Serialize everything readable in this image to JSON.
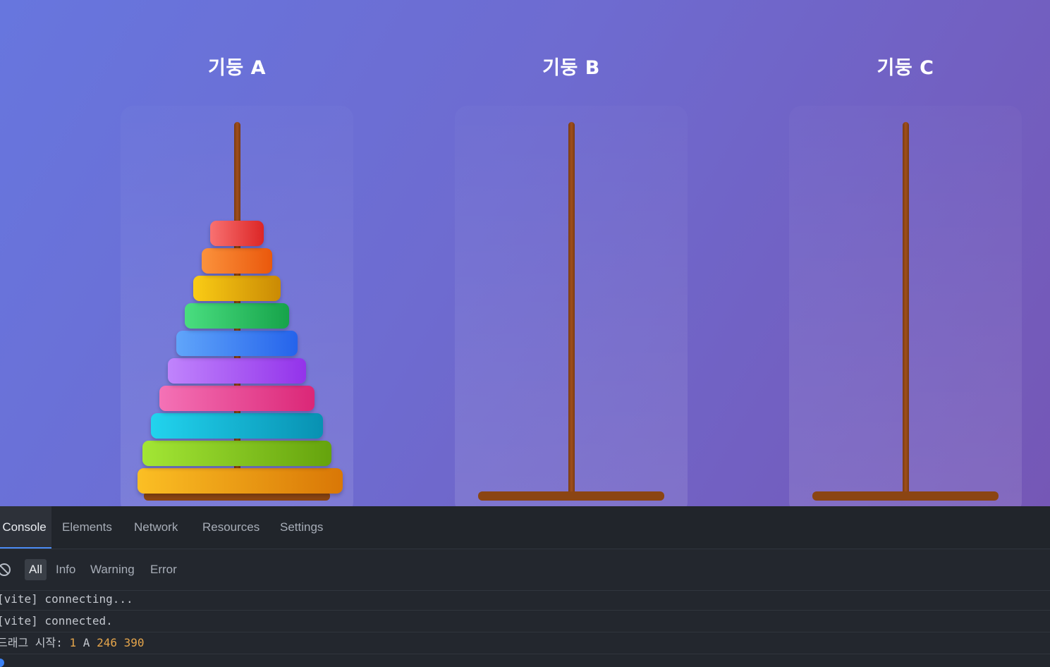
{
  "game": {
    "towers": [
      {
        "id": "A",
        "title": "기둥 A",
        "disks": [
          1,
          2,
          3,
          4,
          5,
          6,
          7,
          8,
          9,
          10
        ]
      },
      {
        "id": "B",
        "title": "기둥 B",
        "disks": []
      },
      {
        "id": "C",
        "title": "기둥 C",
        "disks": []
      }
    ],
    "disk_colors": [
      [
        "#f87171",
        "#dc2626"
      ],
      [
        "#fb923c",
        "#ea580c"
      ],
      [
        "#facc15",
        "#ca8a04"
      ],
      [
        "#4ade80",
        "#16a34a"
      ],
      [
        "#60a5fa",
        "#2563eb"
      ],
      [
        "#c084fc",
        "#9333ea"
      ],
      [
        "#f472b6",
        "#db2777"
      ],
      [
        "#22d3ee",
        "#0891b2"
      ],
      [
        "#a3e635",
        "#65a30d"
      ],
      [
        "#fbbf24",
        "#d97706"
      ]
    ],
    "pole_color": "#8b4513",
    "background": [
      "#6776de",
      "#7557b6"
    ]
  },
  "devtools": {
    "tabs": [
      "Console",
      "Elements",
      "Network",
      "Resources",
      "Settings"
    ],
    "active_tab": "Console",
    "filters": [
      "All",
      "Info",
      "Warning",
      "Error"
    ],
    "active_filter": "All",
    "logs": [
      {
        "text": "[vite] connecting..."
      },
      {
        "text": "[vite] connected."
      },
      {
        "label": "드래그 시작:",
        "values": [
          "1",
          "A",
          "246",
          "390"
        ]
      }
    ]
  }
}
